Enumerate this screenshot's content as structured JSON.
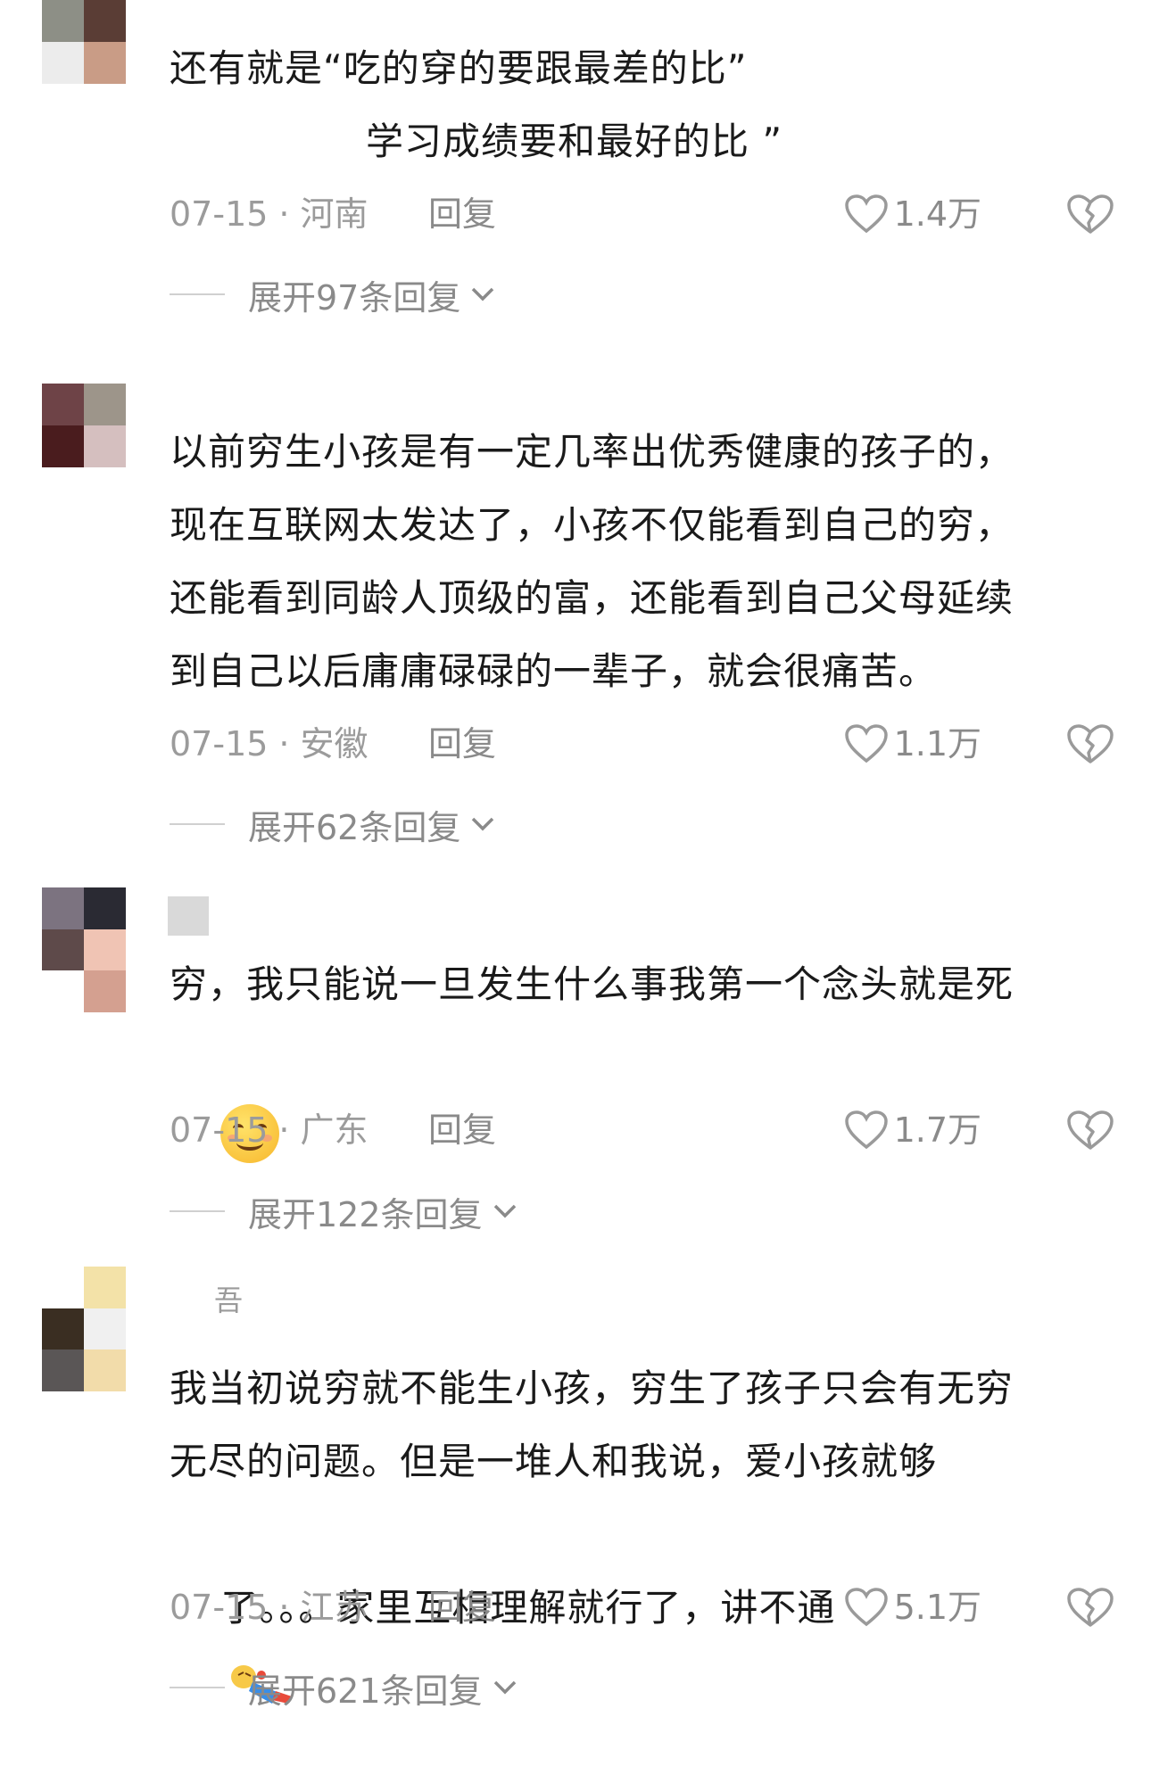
{
  "comments": [
    {
      "lines": [
        "还有就是“吃的穿的要跟最差的比”",
        "学习成绩要和最好的比 ”"
      ],
      "date": "07-15",
      "location": "河南",
      "reply_label": "回复",
      "likes": "1.4万",
      "expand_label": "展开97条回复"
    },
    {
      "lines": [
        "以前穷生小孩是有一定几率出优秀健康的孩子的，",
        "现在互联网太发达了，小孩不仅能看到自己的穷，",
        "还能看到同龄人顶级的富，还能看到自己父母延续",
        "到自己以后庸庸碌碌的一辈子，就会很痛苦。"
      ],
      "date": "07-15",
      "location": "安徽",
      "reply_label": "回复",
      "likes": "1.1万",
      "expand_label": "展开62条回复"
    },
    {
      "lines": [
        "穷，我只能说一旦发生什么事我第一个念头就是死"
      ],
      "emoji": "smile-emoji",
      "date": "07-15",
      "location": "广东",
      "reply_label": "回复",
      "likes": "1.7万",
      "expand_label": "展开122条回复"
    },
    {
      "name_fragment": "吾",
      "lines": [
        "我当初说穷就不能生小孩，穷生了孩子只会有无穷",
        "无尽的问题。但是一堆人和我说，爱小孩就够",
        "了。。。家里互相理解就行了，讲不通"
      ],
      "emoji": "lying-down-emoji",
      "date": "07-15",
      "location": "江苏",
      "reply_label": "回复",
      "likes": "5.1万",
      "expand_label": "展开621条回复"
    }
  ],
  "icons": {
    "like": "heart-outline-icon",
    "dislike": "broken-heart-icon",
    "expand": "chevron-down-icon"
  },
  "colors": {
    "text": "#1a1a1a",
    "meta": "#9b9b9b",
    "background": "#ffffff"
  }
}
